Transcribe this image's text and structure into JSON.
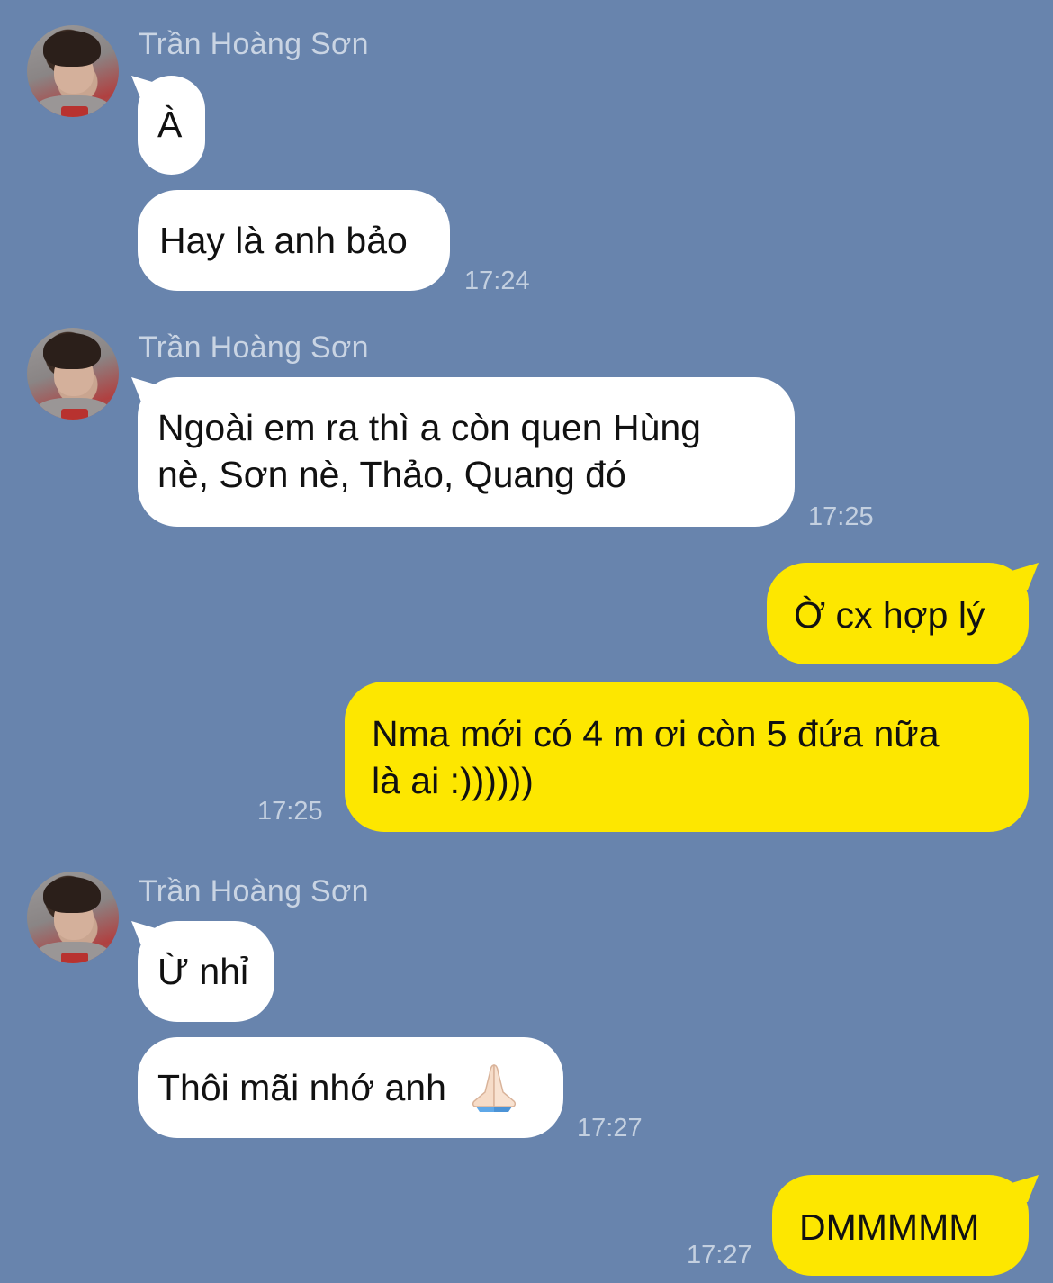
{
  "sender": {
    "name": "Trần Hoàng Sơn"
  },
  "messages": [
    {
      "side": "in",
      "text": "À"
    },
    {
      "side": "in",
      "text": "Hay là anh bảo",
      "time": "17:24"
    },
    {
      "side": "in",
      "text_line1": "Ngoài em ra thì a còn quen Hùng",
      "text_line2": "nè, Sơn nè, Thảo, Quang đó",
      "time": "17:25"
    },
    {
      "side": "out",
      "text": "Ờ cx hợp lý"
    },
    {
      "side": "out",
      "text_line1": "Nma mới có 4 m ơi còn 5 đứa nữa",
      "text_line2": "là ai :))))))",
      "time": "17:25"
    },
    {
      "side": "in",
      "text": "Ừ nhỉ"
    },
    {
      "side": "in",
      "text": "Thôi mãi nhớ anh",
      "emoji": "folded-hands",
      "time": "17:27"
    },
    {
      "side": "out",
      "text": "DMMMMM",
      "time": "17:27"
    }
  ],
  "colors": {
    "background": "#6884ad",
    "incoming_bubble": "#ffffff",
    "outgoing_bubble": "#fde700"
  }
}
